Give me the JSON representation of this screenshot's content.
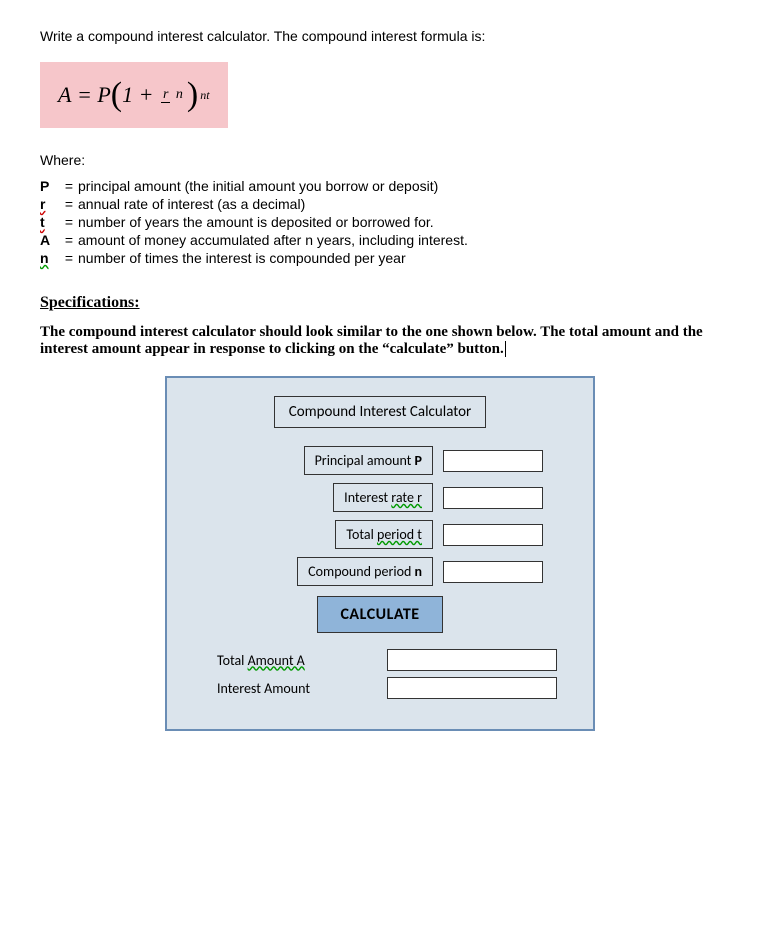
{
  "intro": "Write a compound interest calculator.  The compound interest formula is:",
  "formula": {
    "A": "A",
    "eq": "=",
    "P": "P",
    "lp": "(",
    "one": "1",
    "plus": "+",
    "r": "r",
    "n": "n",
    "rp": ")",
    "exp": "nt"
  },
  "where_label": "Where:",
  "defs": [
    {
      "sym": "P",
      "cls": "",
      "text": "principal amount (the initial amount you borrow or deposit)"
    },
    {
      "sym": "r",
      "cls": "wavy-red",
      "text": "annual rate of interest (as a decimal)"
    },
    {
      "sym": "t",
      "cls": "wavy-red",
      "text": "number of years the amount is deposited or borrowed for."
    },
    {
      "sym": "A",
      "cls": "",
      "text": "amount of money accumulated after n years, including interest."
    },
    {
      "sym": "n",
      "cls": "wavy-green",
      "text": "number of times the interest is compounded per year"
    }
  ],
  "specs_heading": "Specifications:",
  "specs_text": "The compound interest calculator should look similar to the one shown below. The total amount and the interest amount appear in response to clicking on the “calculate” button.",
  "calc": {
    "title": "Compound Interest Calculator",
    "rows": {
      "principal": {
        "pre": "Principal amount ",
        "mid": "",
        "suf": "P"
      },
      "rate": {
        "pre": "Interest ",
        "mid": "rate  r",
        "suf": ""
      },
      "period": {
        "pre": "Total ",
        "mid": "period  t",
        "suf": ""
      },
      "compound": {
        "pre": "Compound period ",
        "mid": "",
        "suf": "n"
      }
    },
    "button": "CALCULATE",
    "outputs": {
      "total": {
        "pre": "Total ",
        "mid": "Amount  A",
        "suf": ""
      },
      "interest": {
        "pre": "Interest Amount",
        "mid": "",
        "suf": ""
      }
    }
  }
}
